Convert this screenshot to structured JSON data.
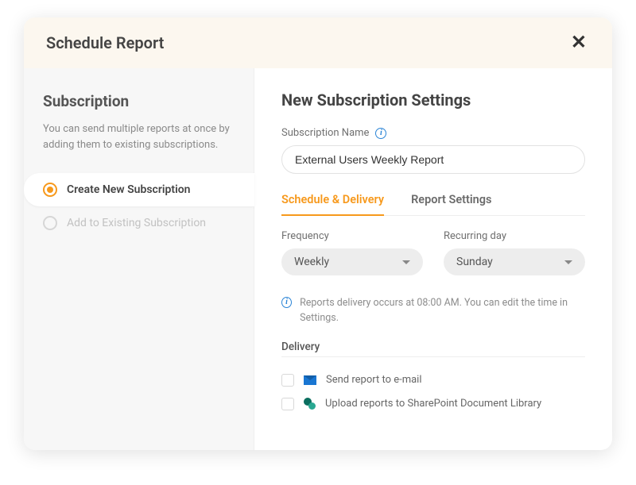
{
  "header": {
    "title": "Schedule Report"
  },
  "sidebar": {
    "title": "Subscription",
    "description": "You can send multiple reports at once by adding them to existing subscriptions.",
    "options": {
      "create": "Create New Subscription",
      "existing": "Add to Existing Subscription"
    }
  },
  "main": {
    "title": "New Subscription Settings",
    "name_label": "Subscription Name",
    "name_value": "External Users Weekly Report",
    "tabs": {
      "schedule": "Schedule & Delivery",
      "settings": "Report Settings"
    },
    "frequency": {
      "label": "Frequency",
      "value": "Weekly"
    },
    "recurring": {
      "label": "Recurring day",
      "value": "Sunday"
    },
    "info_note": "Reports delivery occurs at 08:00 AM. You can edit the time in Settings.",
    "delivery_label": "Delivery",
    "delivery": {
      "email": "Send report to e-mail",
      "sharepoint": "Upload reports to SharePoint Document Library"
    }
  }
}
